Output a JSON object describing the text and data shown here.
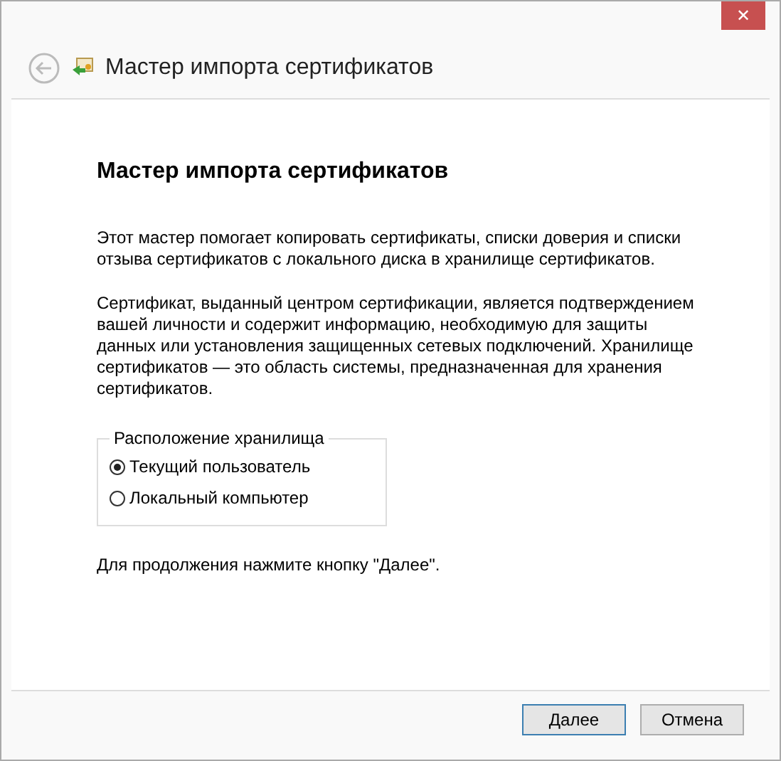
{
  "window": {
    "close": "✕"
  },
  "header": {
    "title": "Мастер импорта сертификатов"
  },
  "content": {
    "heading": "Мастер импорта сертификатов",
    "paragraphs": [
      "Этот мастер помогает копировать сертификаты, списки доверия и списки отзыва сертификатов с локального диска в хранилище сертификатов.",
      "Сертификат, выданный центром сертификации, является подтверждением вашей личности и содержит информацию, необходимую для защиты данных или установления защищенных сетевых подключений. Хранилище сертификатов — это область системы, предназначенная для хранения сертификатов."
    ],
    "store_location": {
      "legend": "Расположение хранилища",
      "options": [
        {
          "label": "Текущий пользователь",
          "selected": true
        },
        {
          "label": "Локальный компьютер",
          "selected": false
        }
      ]
    },
    "hint": "Для продолжения нажмите кнопку \"Далее\"."
  },
  "buttons": [
    {
      "label": "Далее",
      "default": true
    },
    {
      "label": "Отмена",
      "default": false
    }
  ]
}
